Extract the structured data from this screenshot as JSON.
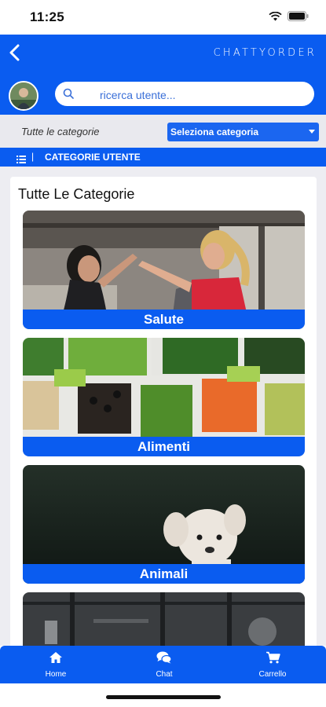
{
  "status_bar": {
    "time": "11:25"
  },
  "header": {
    "logo_text": "CHATTYORDER",
    "back_icon": "chevron-left-icon"
  },
  "search": {
    "placeholder": "ricerca utente..."
  },
  "filter": {
    "label": "Tutte le categorie",
    "select_value": "Seleziona categoria"
  },
  "section": {
    "title": "CATEGORIE UTENTE"
  },
  "content": {
    "heading": "Tutte Le Categorie",
    "categories": [
      {
        "label": "Salute"
      },
      {
        "label": "Alimenti"
      },
      {
        "label": "Animali"
      },
      {
        "label": ""
      }
    ]
  },
  "nav": {
    "items": [
      {
        "label": "Home",
        "icon": "home-icon"
      },
      {
        "label": "Chat",
        "icon": "chat-icon"
      },
      {
        "label": "Carrello",
        "icon": "cart-icon"
      }
    ]
  },
  "colors": {
    "primary": "#0a5cf0",
    "select": "#1b66f0",
    "filter_bg": "#e9e9ee"
  }
}
